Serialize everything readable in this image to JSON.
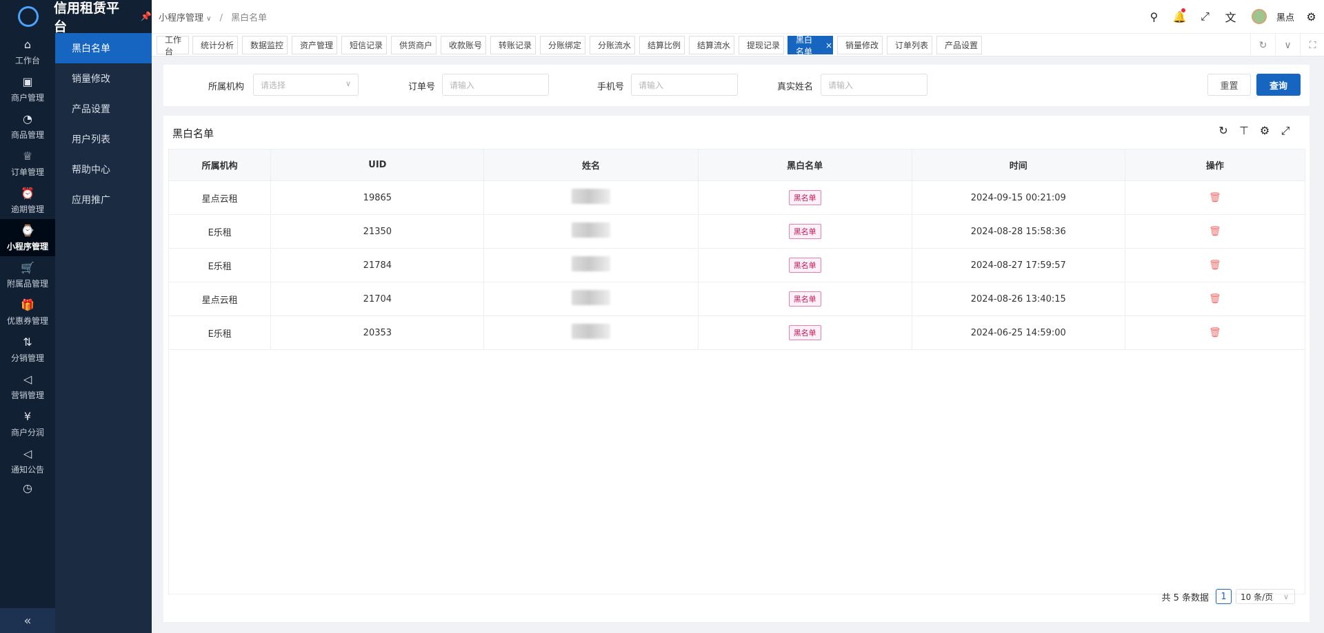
{
  "app": {
    "title": "信用租赁平台"
  },
  "primary_nav": [
    {
      "label": "工作台",
      "icon": "⌂"
    },
    {
      "label": "商户管理",
      "icon": "▣"
    },
    {
      "label": "商品管理",
      "icon": "◔"
    },
    {
      "label": "订单管理",
      "icon": "♕"
    },
    {
      "label": "逾期管理",
      "icon": "⏰"
    },
    {
      "label": "小程序管理",
      "icon": "⌚"
    },
    {
      "label": "附属品管理",
      "icon": "🛒"
    },
    {
      "label": "优惠券管理",
      "icon": "🎁"
    },
    {
      "label": "分销管理",
      "icon": "⇅"
    },
    {
      "label": "营销管理",
      "icon": "◁"
    },
    {
      "label": "商户分润",
      "icon": "¥"
    },
    {
      "label": "通知公告",
      "icon": "◁"
    },
    {
      "label": "",
      "icon": "◷"
    }
  ],
  "secondary_nav": [
    "黑白名单",
    "销量修改",
    "产品设置",
    "用户列表",
    "帮助中心",
    "应用推广"
  ],
  "breadcrumb": {
    "parent": "小程序管理",
    "current": "黑白名单"
  },
  "user": {
    "name": "黑点"
  },
  "tabs": [
    "工作台",
    "统计分析",
    "数据监控",
    "资产管理",
    "短信记录",
    "供货商户",
    "收款账号",
    "转账记录",
    "分账绑定",
    "分账流水",
    "结算比例",
    "结算流水",
    "提现记录",
    "黑白名单",
    "销量修改",
    "订单列表",
    "产品设置"
  ],
  "filter": {
    "org_label": "所属机构",
    "org_placeholder": "请选择",
    "order_label": "订单号",
    "order_placeholder": "请输入",
    "phone_label": "手机号",
    "phone_placeholder": "请输入",
    "name_label": "真实姓名",
    "name_placeholder": "请输入",
    "reset": "重置",
    "query": "查询"
  },
  "panel": {
    "title": "黑白名单"
  },
  "table": {
    "headers": [
      "所属机构",
      "UID",
      "姓名",
      "黑白名单",
      "时间",
      "操作"
    ],
    "rows": [
      {
        "org": "星点云租",
        "uid": "19865",
        "list": "黑名单",
        "time": "2024-09-15 00:21:09"
      },
      {
        "org": "E乐租",
        "uid": "21350",
        "list": "黑名单",
        "time": "2024-08-28 15:58:36"
      },
      {
        "org": "E乐租",
        "uid": "21784",
        "list": "黑名单",
        "time": "2024-08-27 17:59:57"
      },
      {
        "org": "星点云租",
        "uid": "21704",
        "list": "黑名单",
        "time": "2024-08-26 13:40:15"
      },
      {
        "org": "E乐租",
        "uid": "20353",
        "list": "黑名单",
        "time": "2024-06-25 14:59:00"
      }
    ]
  },
  "pagination": {
    "total_text": "共 5 条数据",
    "page": "1",
    "page_size": "10 条/页"
  }
}
